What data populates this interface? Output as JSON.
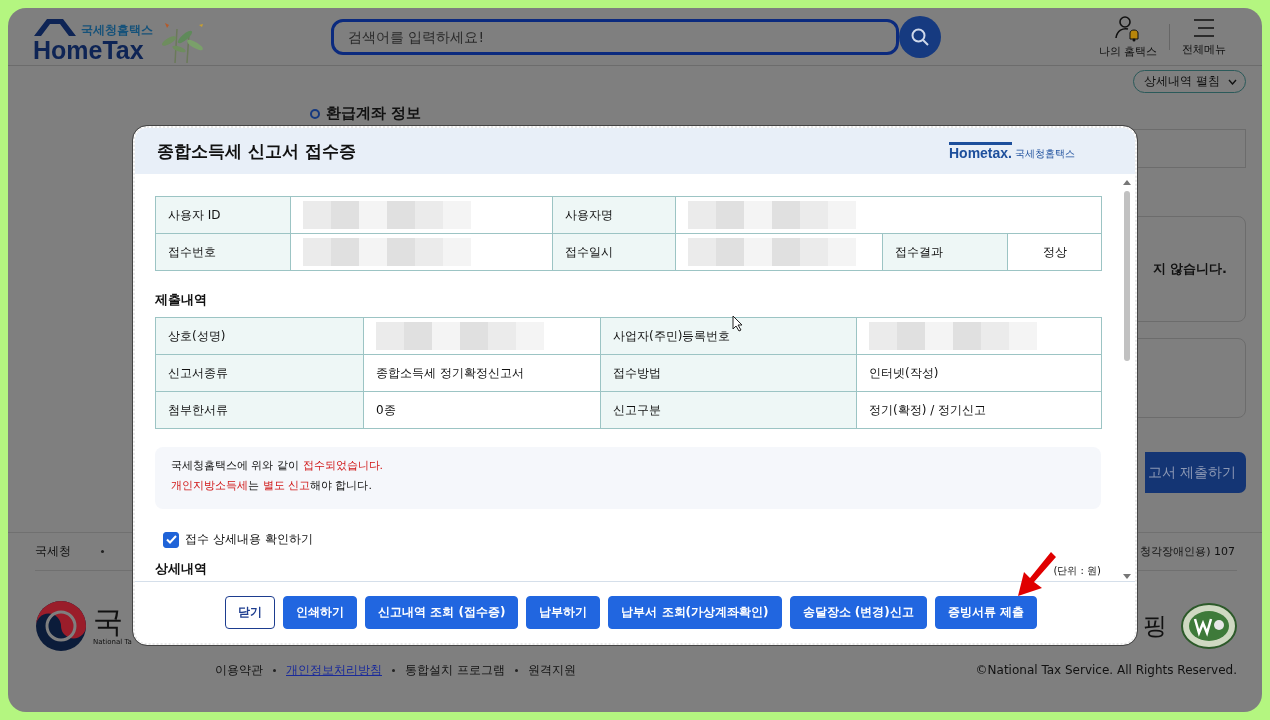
{
  "header": {
    "logo_subtitle": "국세청홈택스",
    "logo_text": "HomeTax",
    "search": {
      "placeholder": "검색어를 입력하세요!"
    },
    "nav": [
      {
        "kind": "user",
        "label": "나의 홈택스"
      },
      {
        "kind": "menu",
        "label": "전체메뉴"
      }
    ]
  },
  "background": {
    "expand_button": "상세내역 펼침",
    "section_title": "환급계좌 정보",
    "notice_fragment": "지 않습니다.",
    "submit_button": "고서 제출하기"
  },
  "dialog": {
    "title": "종합소득세 신고서 접수증",
    "logo": {
      "wordmark": "Hometax.",
      "name": "국세청홈택스"
    },
    "receipt_table": [
      [
        {
          "kind": "label",
          "text": "사용자 ID"
        },
        {
          "kind": "redacted"
        },
        {
          "kind": "label",
          "text": "사용자명"
        },
        {
          "kind": "redacted"
        }
      ],
      [
        {
          "kind": "label",
          "text": "접수번호"
        },
        {
          "kind": "redacted"
        },
        {
          "kind": "label",
          "text": "접수일시"
        },
        {
          "kind": "redacted"
        },
        {
          "kind": "label",
          "text": "접수결과"
        },
        {
          "kind": "value",
          "text": "정상"
        }
      ]
    ],
    "submission_title": "제출내역",
    "submission_table": [
      [
        {
          "kind": "label",
          "text": "상호(성명)"
        },
        {
          "kind": "redacted"
        },
        {
          "kind": "label",
          "text": "사업자(주민)등록번호"
        },
        {
          "kind": "redacted"
        }
      ],
      [
        {
          "kind": "label",
          "text": "신고서종류"
        },
        {
          "kind": "value",
          "text": "종합소득세 정기확정신고서"
        },
        {
          "kind": "label",
          "text": "접수방법"
        },
        {
          "kind": "value",
          "text": "인터넷(작성)"
        }
      ],
      [
        {
          "kind": "label",
          "text": "첨부한서류"
        },
        {
          "kind": "value",
          "text": "0종"
        },
        {
          "kind": "label",
          "text": "신고구분"
        },
        {
          "kind": "value",
          "text": "정기(확정) / 정기신고"
        }
      ]
    ],
    "notice": [
      [
        {
          "text": "국세청홈택스에 위와 같이 ",
          "highlight": false
        },
        {
          "text": "접수되었습니다.",
          "highlight": true
        }
      ],
      [
        {
          "text": "개인지방소득세",
          "highlight": true
        },
        {
          "text": "는 ",
          "highlight": false
        },
        {
          "text": "별도 신고",
          "highlight": true
        },
        {
          "text": "해야 합니다.",
          "highlight": false
        }
      ]
    ],
    "checkbox": {
      "label": "접수 상세내용 확인하기",
      "checked": true
    },
    "detail_title": "상세내역",
    "unit_note": "(단위 : 원)",
    "buttons": [
      {
        "kind": "outline",
        "label": "닫기"
      },
      {
        "kind": "primary",
        "label": "인쇄하기"
      },
      {
        "kind": "primary",
        "label": "신고내역 조회 (접수증)"
      },
      {
        "kind": "primary",
        "label": "납부하기"
      },
      {
        "kind": "primary",
        "label": "납부서 조회(가상계좌확인)"
      },
      {
        "kind": "primary",
        "label": "송달장소 (변경)신고"
      },
      {
        "kind": "primary",
        "label": "증빙서류 제출"
      }
    ]
  },
  "footer": {
    "info_left": "국세청",
    "info_right": "청각장애인용) 107",
    "agency_name": "국",
    "agency_english": "National Ta",
    "badge_fragment": "핑",
    "links": [
      {
        "label": "이용약관",
        "underlined": false
      },
      {
        "label": "개인정보처리방침",
        "underlined": true
      },
      {
        "label": "통합설치 프로그램",
        "underlined": false
      },
      {
        "label": "원격지원",
        "underlined": false
      }
    ],
    "copyright": "©National Tax Service. All Rights Reserved."
  }
}
